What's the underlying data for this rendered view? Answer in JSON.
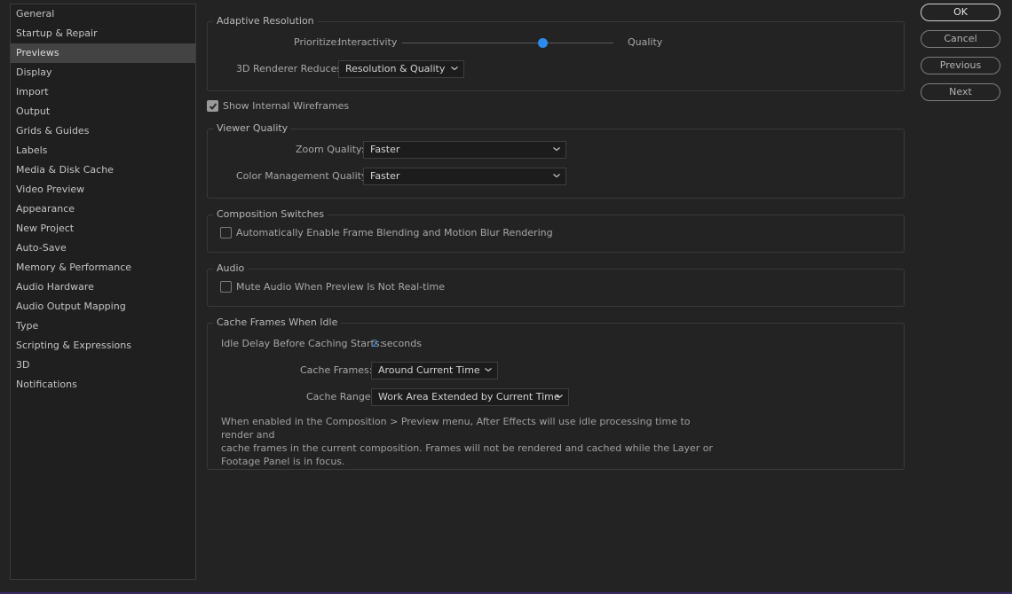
{
  "sidebar": {
    "items": [
      {
        "label": "General"
      },
      {
        "label": "Startup & Repair"
      },
      {
        "label": "Previews"
      },
      {
        "label": "Display"
      },
      {
        "label": "Import"
      },
      {
        "label": "Output"
      },
      {
        "label": "Grids & Guides"
      },
      {
        "label": "Labels"
      },
      {
        "label": "Media & Disk Cache"
      },
      {
        "label": "Video Preview"
      },
      {
        "label": "Appearance"
      },
      {
        "label": "New Project"
      },
      {
        "label": "Auto-Save"
      },
      {
        "label": "Memory & Performance"
      },
      {
        "label": "Audio Hardware"
      },
      {
        "label": "Audio Output Mapping"
      },
      {
        "label": "Type"
      },
      {
        "label": "Scripting & Expressions"
      },
      {
        "label": "3D"
      },
      {
        "label": "Notifications"
      }
    ],
    "selected": "Previews"
  },
  "adaptive_resolution": {
    "title": "Adaptive Resolution",
    "prioritize_label": "Prioritize:",
    "left_label": "Interactivity",
    "right_label": "Quality",
    "slider_value": 0.8,
    "renderer_label": "3D Renderer Reduces:",
    "renderer_value": "Resolution & Quality"
  },
  "show_wireframes": {
    "label": "Show Internal Wireframes",
    "checked": true
  },
  "viewer_quality": {
    "title": "Viewer Quality",
    "zoom_label": "Zoom Quality:",
    "zoom_value": "Faster",
    "color_label": "Color Management Quality:",
    "color_value": "Faster"
  },
  "composition_switches": {
    "title": "Composition Switches",
    "blend_label": "Automatically Enable Frame Blending and Motion Blur Rendering",
    "blend_checked": false
  },
  "audio": {
    "title": "Audio",
    "mute_label": "Mute Audio When Preview Is Not Real-time",
    "mute_checked": false
  },
  "cache_idle": {
    "title": "Cache Frames When Idle",
    "delay_label": "Idle Delay Before Caching Starts:",
    "delay_value": "2",
    "delay_unit": "seconds",
    "frames_label": "Cache Frames:",
    "frames_value": "Around Current Time",
    "range_label": "Cache Range:",
    "range_value": "Work Area Extended by Current Time",
    "description_line1": "When enabled in the Composition > Preview menu, After Effects will use idle processing time to render and",
    "description_line2": "cache frames in the current composition. Frames will not be rendered and cached while the Layer or",
    "description_line3": "Footage Panel is in focus."
  },
  "buttons": {
    "ok": "OK",
    "cancel": "Cancel",
    "previous": "Previous",
    "next": "Next"
  },
  "colors": {
    "accent": "#2d8ceb",
    "background": "#232323",
    "selected_row": "#434343"
  }
}
